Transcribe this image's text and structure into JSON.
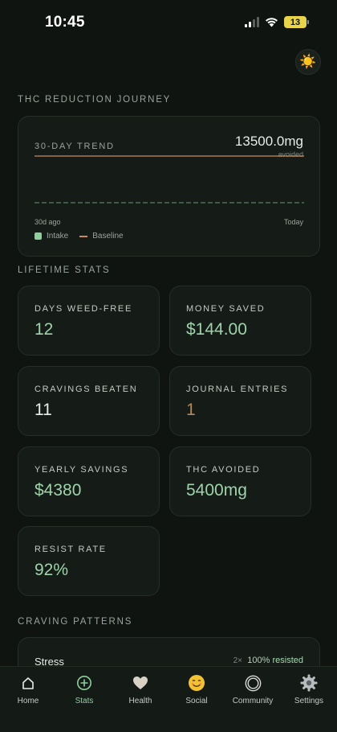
{
  "status_bar": {
    "time": "10:45",
    "battery": "13"
  },
  "header": {
    "theme_icon": "sun-icon"
  },
  "journey": {
    "section_title": "THC REDUCTION JOURNEY",
    "trend_label": "30-DAY TREND",
    "total_value": "13500.0mg",
    "total_caption": "avoided",
    "axis_start": "30d ago",
    "axis_end": "Today",
    "legend_intake": "Intake",
    "legend_baseline": "Baseline"
  },
  "chart_data": {
    "type": "line",
    "x_start": "30d ago",
    "x_end": "Today",
    "series": [
      {
        "name": "Intake",
        "values": [
          0,
          0,
          0,
          0,
          0,
          0,
          0,
          0,
          0,
          0,
          0,
          0,
          0,
          0,
          0,
          0,
          0,
          0,
          0,
          0,
          0,
          0,
          0,
          0,
          0,
          0,
          0,
          0,
          0,
          0,
          0
        ]
      },
      {
        "name": "Baseline",
        "values": [
          450,
          450,
          450,
          450,
          450,
          450,
          450,
          450,
          450,
          450,
          450,
          450,
          450,
          450,
          450,
          450,
          450,
          450,
          450,
          450,
          450,
          450,
          450,
          450,
          450,
          450,
          450,
          450,
          450,
          450,
          450
        ]
      }
    ],
    "colors": {
      "Intake": "#8fcf9c",
      "Baseline": "#c98a5c"
    },
    "legend": "bottom-left",
    "grid": false
  },
  "lifetime": {
    "section_title": "LIFETIME STATS",
    "stats": [
      {
        "label": "DAYS WEED-FREE",
        "value": "12",
        "color": "#9fd3aa"
      },
      {
        "label": "MONEY SAVED",
        "value": "$144.00",
        "color": "#9fd3aa"
      },
      {
        "label": "CRAVINGS BEATEN",
        "value": "11",
        "color": "#e6ece7"
      },
      {
        "label": "JOURNAL ENTRIES",
        "value": "1",
        "color": "#b0895f"
      },
      {
        "label": "YEARLY SAVINGS",
        "value": "$4380",
        "color": "#9fd3aa"
      },
      {
        "label": "THC AVOIDED",
        "value": "5400mg",
        "color": "#9fd3aa"
      },
      {
        "label": "RESIST RATE",
        "value": "92%",
        "color": "#9fd3aa"
      }
    ]
  },
  "patterns": {
    "section_title": "CRAVING PATTERNS",
    "items": [
      {
        "name": "Stress",
        "count": "2×",
        "rate": "100% resisted"
      }
    ]
  },
  "tabs": [
    {
      "label": "Home",
      "icon": "home-icon",
      "glyph": "⌂"
    },
    {
      "label": "Stats",
      "icon": "stats-icon",
      "glyph": "⊕"
    },
    {
      "label": "Health",
      "icon": "heart-icon",
      "glyph": "♥"
    },
    {
      "label": "Social",
      "icon": "smile-icon",
      "glyph": "☺"
    },
    {
      "label": "Community",
      "icon": "circle-icon",
      "glyph": "◎"
    },
    {
      "label": "Settings",
      "icon": "gear-icon",
      "glyph": "⚙"
    }
  ],
  "active_tab": "Stats"
}
